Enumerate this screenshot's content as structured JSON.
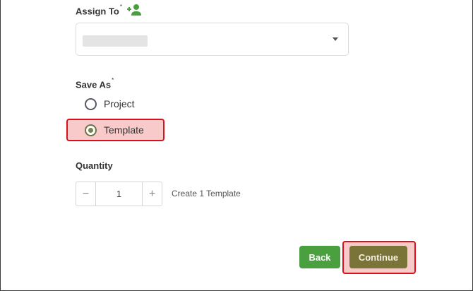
{
  "assign_to": {
    "label": "Assign To",
    "required_mark": "*",
    "add_icon": "add-user-icon",
    "select": {
      "value": "",
      "redacted": true
    }
  },
  "save_as": {
    "label": "Save As",
    "required_mark": "*",
    "options": [
      {
        "label": "Project",
        "checked": false
      },
      {
        "label": "Template",
        "checked": true
      }
    ]
  },
  "quantity": {
    "label": "Quantity",
    "minus": "−",
    "value": "1",
    "plus": "+",
    "helper_text": "Create 1 Template"
  },
  "actions": {
    "back_label": "Back",
    "continue_label": "Continue"
  },
  "colors": {
    "back_button": "#4aa03f",
    "continue_button": "#7b7438",
    "highlight_border": "#d8121c",
    "highlight_fill": "#f8caca"
  }
}
